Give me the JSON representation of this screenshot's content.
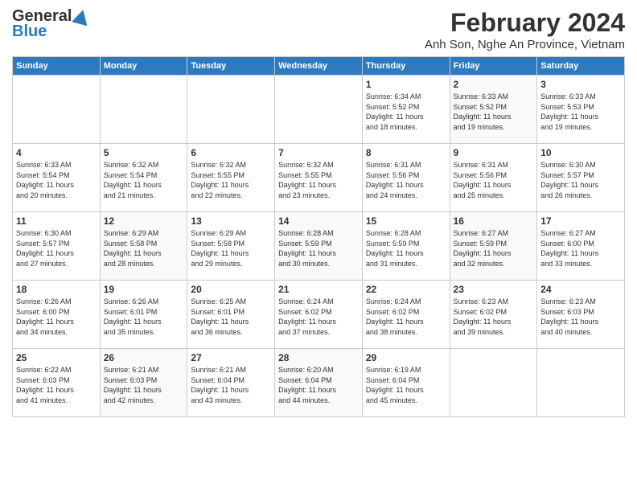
{
  "header": {
    "logo_general": "General",
    "logo_blue": "Blue",
    "month_title": "February 2024",
    "location": "Anh Son, Nghe An Province, Vietnam"
  },
  "days_of_week": [
    "Sunday",
    "Monday",
    "Tuesday",
    "Wednesday",
    "Thursday",
    "Friday",
    "Saturday"
  ],
  "weeks": [
    [
      {
        "day": "",
        "text": ""
      },
      {
        "day": "",
        "text": ""
      },
      {
        "day": "",
        "text": ""
      },
      {
        "day": "",
        "text": ""
      },
      {
        "day": "1",
        "text": "Sunrise: 6:34 AM\nSunset: 5:52 PM\nDaylight: 11 hours\nand 18 minutes."
      },
      {
        "day": "2",
        "text": "Sunrise: 6:33 AM\nSunset: 5:52 PM\nDaylight: 11 hours\nand 19 minutes."
      },
      {
        "day": "3",
        "text": "Sunrise: 6:33 AM\nSunset: 5:53 PM\nDaylight: 11 hours\nand 19 minutes."
      }
    ],
    [
      {
        "day": "4",
        "text": "Sunrise: 6:33 AM\nSunset: 5:54 PM\nDaylight: 11 hours\nand 20 minutes."
      },
      {
        "day": "5",
        "text": "Sunrise: 6:32 AM\nSunset: 5:54 PM\nDaylight: 11 hours\nand 21 minutes."
      },
      {
        "day": "6",
        "text": "Sunrise: 6:32 AM\nSunset: 5:55 PM\nDaylight: 11 hours\nand 22 minutes."
      },
      {
        "day": "7",
        "text": "Sunrise: 6:32 AM\nSunset: 5:55 PM\nDaylight: 11 hours\nand 23 minutes."
      },
      {
        "day": "8",
        "text": "Sunrise: 6:31 AM\nSunset: 5:56 PM\nDaylight: 11 hours\nand 24 minutes."
      },
      {
        "day": "9",
        "text": "Sunrise: 6:31 AM\nSunset: 5:56 PM\nDaylight: 11 hours\nand 25 minutes."
      },
      {
        "day": "10",
        "text": "Sunrise: 6:30 AM\nSunset: 5:57 PM\nDaylight: 11 hours\nand 26 minutes."
      }
    ],
    [
      {
        "day": "11",
        "text": "Sunrise: 6:30 AM\nSunset: 5:57 PM\nDaylight: 11 hours\nand 27 minutes."
      },
      {
        "day": "12",
        "text": "Sunrise: 6:29 AM\nSunset: 5:58 PM\nDaylight: 11 hours\nand 28 minutes."
      },
      {
        "day": "13",
        "text": "Sunrise: 6:29 AM\nSunset: 5:58 PM\nDaylight: 11 hours\nand 29 minutes."
      },
      {
        "day": "14",
        "text": "Sunrise: 6:28 AM\nSunset: 5:59 PM\nDaylight: 11 hours\nand 30 minutes."
      },
      {
        "day": "15",
        "text": "Sunrise: 6:28 AM\nSunset: 5:59 PM\nDaylight: 11 hours\nand 31 minutes."
      },
      {
        "day": "16",
        "text": "Sunrise: 6:27 AM\nSunset: 5:59 PM\nDaylight: 11 hours\nand 32 minutes."
      },
      {
        "day": "17",
        "text": "Sunrise: 6:27 AM\nSunset: 6:00 PM\nDaylight: 11 hours\nand 33 minutes."
      }
    ],
    [
      {
        "day": "18",
        "text": "Sunrise: 6:26 AM\nSunset: 6:00 PM\nDaylight: 11 hours\nand 34 minutes."
      },
      {
        "day": "19",
        "text": "Sunrise: 6:26 AM\nSunset: 6:01 PM\nDaylight: 11 hours\nand 35 minutes."
      },
      {
        "day": "20",
        "text": "Sunrise: 6:25 AM\nSunset: 6:01 PM\nDaylight: 11 hours\nand 36 minutes."
      },
      {
        "day": "21",
        "text": "Sunrise: 6:24 AM\nSunset: 6:02 PM\nDaylight: 11 hours\nand 37 minutes."
      },
      {
        "day": "22",
        "text": "Sunrise: 6:24 AM\nSunset: 6:02 PM\nDaylight: 11 hours\nand 38 minutes."
      },
      {
        "day": "23",
        "text": "Sunrise: 6:23 AM\nSunset: 6:02 PM\nDaylight: 11 hours\nand 39 minutes."
      },
      {
        "day": "24",
        "text": "Sunrise: 6:23 AM\nSunset: 6:03 PM\nDaylight: 11 hours\nand 40 minutes."
      }
    ],
    [
      {
        "day": "25",
        "text": "Sunrise: 6:22 AM\nSunset: 6:03 PM\nDaylight: 11 hours\nand 41 minutes."
      },
      {
        "day": "26",
        "text": "Sunrise: 6:21 AM\nSunset: 6:03 PM\nDaylight: 11 hours\nand 42 minutes."
      },
      {
        "day": "27",
        "text": "Sunrise: 6:21 AM\nSunset: 6:04 PM\nDaylight: 11 hours\nand 43 minutes."
      },
      {
        "day": "28",
        "text": "Sunrise: 6:20 AM\nSunset: 6:04 PM\nDaylight: 11 hours\nand 44 minutes."
      },
      {
        "day": "29",
        "text": "Sunrise: 6:19 AM\nSunset: 6:04 PM\nDaylight: 11 hours\nand 45 minutes."
      },
      {
        "day": "",
        "text": ""
      },
      {
        "day": "",
        "text": ""
      }
    ]
  ]
}
